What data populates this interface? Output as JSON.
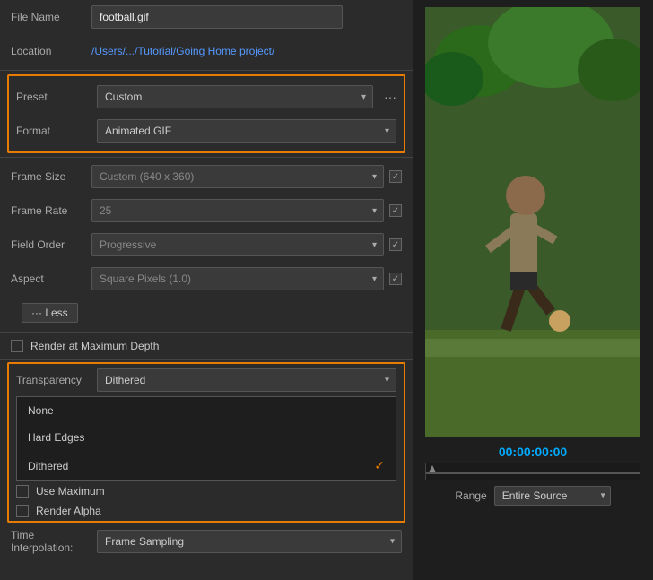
{
  "left": {
    "file_name_label": "File Name",
    "file_name_value": "football.gif",
    "location_label": "Location",
    "location_value": "/Users/.../Tutorial/Going Home project/",
    "preset_label": "Preset",
    "preset_value": "Custom",
    "format_label": "Format",
    "format_value": "Animated GIF",
    "frame_size_label": "Frame Size",
    "frame_size_value": "Custom (640 x 360)",
    "frame_rate_label": "Frame Rate",
    "frame_rate_value": "25",
    "field_order_label": "Field Order",
    "field_order_value": "Progressive",
    "aspect_label": "Aspect",
    "aspect_value": "Square Pixels (1.0)",
    "less_btn": "··· Less",
    "render_at_max": "Render at Maximum Depth",
    "transparency_label": "Transparency",
    "transparency_value": "Dithered",
    "use_maximum_label": "Use Maximum",
    "render_alpha_label": "Render Alpha",
    "time_interp_label": "Time\nInterpolation:",
    "time_interp_value": "Frame Sampling",
    "dropdown_none": "None",
    "dropdown_hard_edges": "Hard Edges",
    "dropdown_dithered": "Dithered",
    "more_dots": "···"
  },
  "right": {
    "time_display": "00:00:00:00",
    "range_label": "Range",
    "range_value": "Entire Source"
  }
}
